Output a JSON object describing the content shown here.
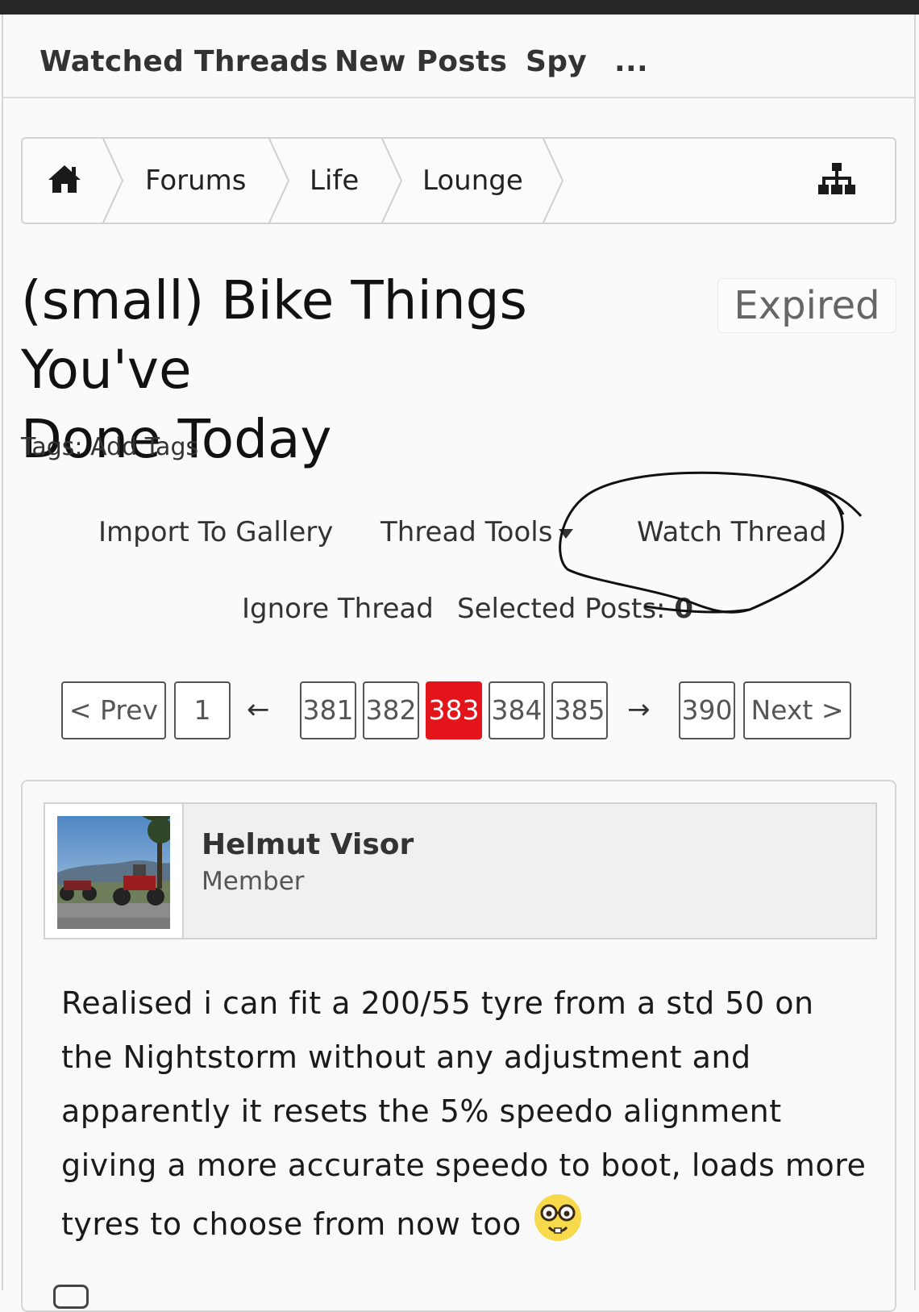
{
  "nav": {
    "items": [
      "Watched Threads",
      "New Posts",
      "Spy",
      "..."
    ]
  },
  "breadcrumb": {
    "home_icon": "home-icon",
    "items": [
      "Forums",
      "Life",
      "Lounge"
    ],
    "sitemap_icon": "sitemap-icon"
  },
  "thread": {
    "title_line1": "(small) Bike Things You've",
    "title_line2": "Done Today",
    "badge": "Expired",
    "tags_label": "Tags:",
    "tags_link": "Add Tags"
  },
  "tools": {
    "import_gallery": "Import To Gallery",
    "thread_tools": "Thread Tools",
    "watch_thread": "Watch Thread",
    "ignore_thread": "Ignore Thread",
    "selected_posts_label": "Selected Posts:",
    "selected_posts_count": "0"
  },
  "pagination": {
    "prev": "< Prev",
    "first": "1",
    "left_arrow": "←",
    "pages": [
      "381",
      "382",
      "383",
      "384",
      "385"
    ],
    "current": "383",
    "right_arrow": "→",
    "last": "390",
    "next": "Next >",
    "accent_color": "#e3151a"
  },
  "post": {
    "username": "Helmut Visor",
    "role": "Member",
    "body": "Realised i can fit a 200/55 tyre from a std 50 on the Nightstorm without any adjustment and apparently it resets the 5% speedo alignment giving a more accurate speedo to boot, loads more tyres to choose from now too",
    "emoji": "nerd-face-emoji"
  }
}
